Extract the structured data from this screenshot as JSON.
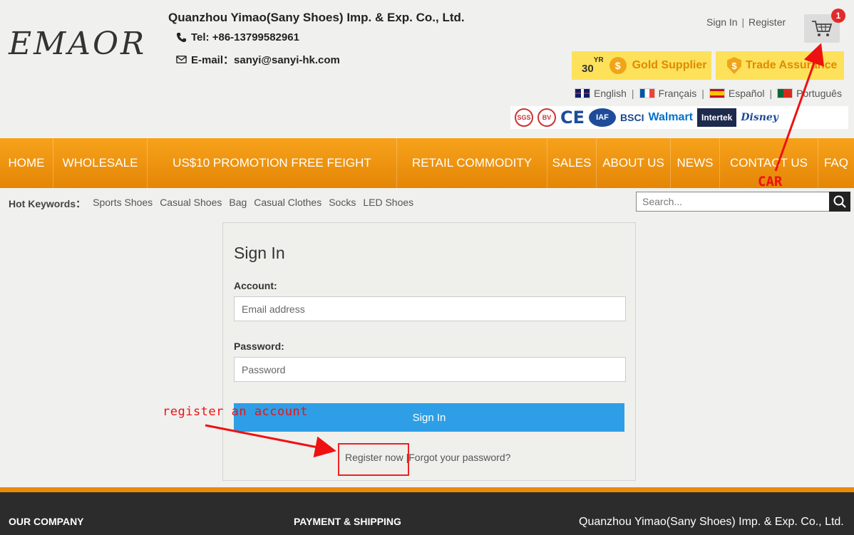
{
  "header": {
    "logo": "EMAOR",
    "company_name": "Quanzhou Yimao(Sany Shoes) Imp. & Exp. Co., Ltd.",
    "tel": "Tel: +86-13799582961",
    "email": "E-mail：sanyi@sanyi-hk.com",
    "sign_in": "Sign In",
    "separator": "|",
    "register": "Register",
    "cart_count": "1"
  },
  "badges": {
    "years": "30",
    "years_suffix": "YR",
    "gold_supplier": "Gold Supplier",
    "trade_assurance": "Trade Assurance"
  },
  "languages": [
    {
      "label": "English",
      "flag": "uk-flag"
    },
    {
      "label": "Français",
      "flag": "france-flag"
    },
    {
      "label": "Español",
      "flag": "spain-flag"
    },
    {
      "label": "Português",
      "flag": "portugal-flag"
    }
  ],
  "certifications": [
    "SGS",
    "BV",
    "CE",
    "IAF",
    "BSCI",
    "Walmart",
    "Intertek",
    "Disney"
  ],
  "nav": [
    "HOME",
    "WHOLESALE",
    "US$10 PROMOTION FREE FEIGHT",
    "RETAIL COMMODITY",
    "SALES",
    "ABOUT US",
    "NEWS",
    "CONTACT US",
    "FAQ"
  ],
  "hot_keywords": {
    "label": "Hot Keywords：",
    "items": [
      "Sports Shoes",
      "Casual Shoes",
      "Bag",
      "Casual Clothes",
      "Socks",
      "LED Shoes"
    ]
  },
  "search": {
    "placeholder": "Search..."
  },
  "signin": {
    "title": "Sign In",
    "account_label": "Account:",
    "account_placeholder": "Email address",
    "password_label": "Password:",
    "password_placeholder": "Password",
    "button": "Sign In",
    "register_now": "Register now",
    "separator": "|",
    "forgot": "Forgot your password?"
  },
  "annotations": {
    "register": "register an account",
    "car": "CAR",
    "color": "#e11111"
  },
  "footer": {
    "our_company": "OUR COMPANY",
    "payment": "PAYMENT & SHIPPING",
    "company_name": "Quanzhou Yimao(Sany Shoes) Imp. & Exp. Co., Ltd."
  },
  "colors": {
    "nav_orange": "#f29412",
    "signin_blue": "#2e9fe6",
    "badge_yellow": "#fde15a",
    "footer_dark": "#2c2c2c"
  }
}
